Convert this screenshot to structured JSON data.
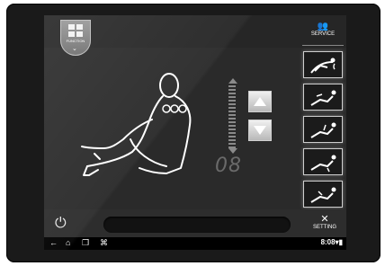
{
  "function_tab": {
    "label": "FUNCTION",
    "icon": "grid-icon"
  },
  "service": {
    "label": "SERVICE",
    "icon": "service-users-icon"
  },
  "setting": {
    "label": "SETTING",
    "icon": "wrench-screwdriver-icon"
  },
  "display": {
    "value": "08"
  },
  "side_buttons": [
    {
      "icon": "recline-speed-icon"
    },
    {
      "icon": "recline-massage-1-icon"
    },
    {
      "icon": "recline-massage-2-icon"
    },
    {
      "icon": "recline-massage-3-icon"
    },
    {
      "icon": "recline-massage-4-icon"
    }
  ],
  "nav": {
    "back": "←",
    "home": "⌂",
    "recent": "❐",
    "menu": "⌘",
    "time": "8:08"
  },
  "colors": {
    "screen": "#2a2a2a",
    "bezel": "#1a1a1a",
    "outline": "#ffffff"
  }
}
